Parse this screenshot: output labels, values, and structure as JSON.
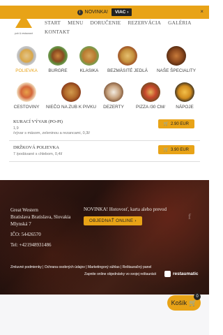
{
  "notice": {
    "text": "NOVINKA!",
    "button": "VIAC ›",
    "close": "×"
  },
  "logo": {
    "tagline": "pub & restaurant"
  },
  "nav": [
    "START",
    "MENU",
    "DORUČENIE",
    "REZERVÁCIA",
    "GALÉRIA",
    "KONTAKT"
  ],
  "categories_row1": [
    "POLIEVKA",
    "BURGRE",
    "KLASIKA",
    "BEZMÄSITÉ JEDLÁ",
    "NAŠE ŠPECIALITY"
  ],
  "categories_row2": [
    "CESTOVINY",
    "NIEČO NA ZUB K PIVKU",
    "DEZERTY",
    "PIZZA /30 CM/",
    "NÁPOJE"
  ],
  "items": [
    {
      "name": "KURACÍ VÝVAR (PO-PI)",
      "code": "1,9",
      "desc": "/vývar s mäsom, zeleninou a rezancami, 0,3l/",
      "price": "2.90 EUR"
    },
    {
      "name": "DRŽKOVÁ POLIEVKA",
      "code": "7",
      "desc": "/podávané s chlebom, 0,4l/",
      "price": "3.90 EUR"
    }
  ],
  "footer": {
    "name": "Great Western",
    "city": "Bratislava Bratislava, Slovakia",
    "street": "Mlynská 7",
    "ico": "IČO: 54426570",
    "tel": "Tel: +421948931486",
    "news": "NOVINKA! Hotovosť, karta alebo prevod",
    "order_button": "OBJEDNAŤ ONLINE ›",
    "fb": "f",
    "links": "Zmluvné podmienky | Ochrana osobných údajov | Marketingový súhlas | Reštauračný panel",
    "online": "Zapnite online objednávky vo svojej reštaurácii",
    "brand": "restaumatic"
  },
  "cart": {
    "label": "Košík",
    "count": "0"
  },
  "colors": {
    "accent": "#e8a317",
    "footer": "#2a140e"
  }
}
